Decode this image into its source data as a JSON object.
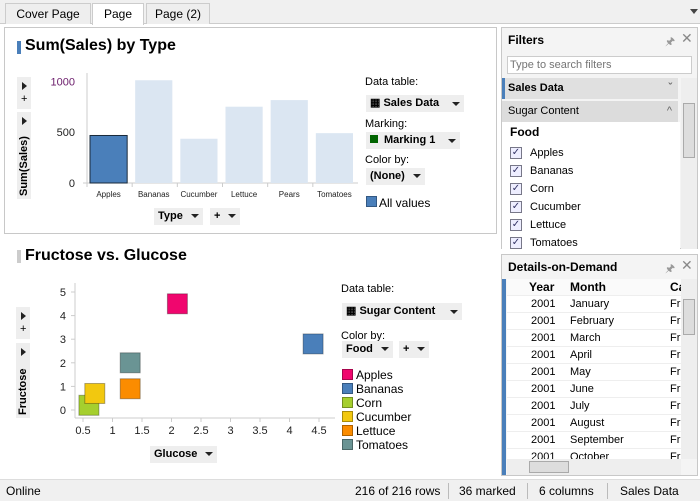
{
  "tabs": [
    {
      "label": "Cover Page"
    },
    {
      "label": "Page"
    },
    {
      "label": "Page (2)"
    }
  ],
  "bar_viz": {
    "title": "Sum(Sales) by Type",
    "y_axis": "Sum(Sales)",
    "x_axis": "Type",
    "add": "+",
    "data_table_label": "Data table:",
    "data_table": "Sales Data",
    "marking_label": "Marking:",
    "marking": "Marking 1",
    "marking_color": "#006400",
    "color_by_label": "Color by:",
    "color_by": "(None)",
    "legend": "All values",
    "accent": "#4a7fba"
  },
  "scatter_viz": {
    "title": "Fructose vs. Glucose",
    "y_axis": "Fructose",
    "x_axis": "Glucose",
    "data_table_label": "Data table:",
    "data_table": "Sugar Content",
    "color_by_label": "Color by:",
    "color_by": "Food",
    "add": "+"
  },
  "chart_data": [
    {
      "type": "bar",
      "categories": [
        "Apples",
        "Bananas",
        "Cucumber",
        "Lettuce",
        "Pears",
        "Tomatoes"
      ],
      "values": [
        467,
        1010,
        435,
        750,
        815,
        490
      ],
      "marked": [
        "Apples"
      ],
      "marked_color": "#4a7fba",
      "unmarked_color": "#dbe6f2",
      "yticks": [
        0,
        500,
        1000
      ],
      "ylim": [
        0,
        1150
      ],
      "ylabel": "Sum(Sales)",
      "xlabel": "Type",
      "legend": "right"
    },
    {
      "type": "scatter",
      "xlabel": "Glucose",
      "ylabel": "Fructose",
      "xticks": [
        0.5,
        1,
        1.5,
        2,
        2.5,
        3,
        3.5,
        4,
        4.5
      ],
      "yticks": [
        0,
        1,
        2,
        3,
        4,
        5
      ],
      "xlim": [
        0.4,
        4.6
      ],
      "ylim": [
        -0.4,
        5.2
      ],
      "legend": "right",
      "points": [
        {
          "name": "Apples",
          "x": 2.1,
          "y": 4.5,
          "color": "#f0066e"
        },
        {
          "name": "Bananas",
          "x": 4.4,
          "y": 2.8,
          "color": "#4a7fba"
        },
        {
          "name": "Corn",
          "x": 0.6,
          "y": 0.2,
          "color": "#a5cf2e"
        },
        {
          "name": "Cucumber",
          "x": 0.7,
          "y": 0.7,
          "color": "#f2c80f"
        },
        {
          "name": "Lettuce",
          "x": 1.3,
          "y": 0.9,
          "color": "#fb8c00"
        },
        {
          "name": "Tomatoes",
          "x": 1.3,
          "y": 2.0,
          "color": "#6a9494"
        }
      ]
    }
  ],
  "filters": {
    "title": "Filters",
    "search_placeholder": "Type to search filters",
    "groups": [
      "Sales Data",
      "Sugar Content"
    ],
    "field": "Food",
    "items": [
      "Apples",
      "Bananas",
      "Corn",
      "Cucumber",
      "Lettuce",
      "Tomatoes"
    ]
  },
  "details": {
    "title": "Details-on-Demand",
    "columns": [
      "Year",
      "Month",
      "Ca"
    ],
    "rows": [
      [
        "2001",
        "January",
        "Fr"
      ],
      [
        "2001",
        "February",
        "Fr"
      ],
      [
        "2001",
        "March",
        "Fr"
      ],
      [
        "2001",
        "April",
        "Fr"
      ],
      [
        "2001",
        "May",
        "Fr"
      ],
      [
        "2001",
        "June",
        "Fr"
      ],
      [
        "2001",
        "July",
        "Fr"
      ],
      [
        "2001",
        "August",
        "Fr"
      ],
      [
        "2001",
        "September",
        "Fr"
      ],
      [
        "2001",
        "October",
        "Fr"
      ]
    ]
  },
  "status": {
    "state": "Online",
    "rows": "216 of 216 rows",
    "marked": "36 marked",
    "columns": "6 columns",
    "table": "Sales Data"
  }
}
